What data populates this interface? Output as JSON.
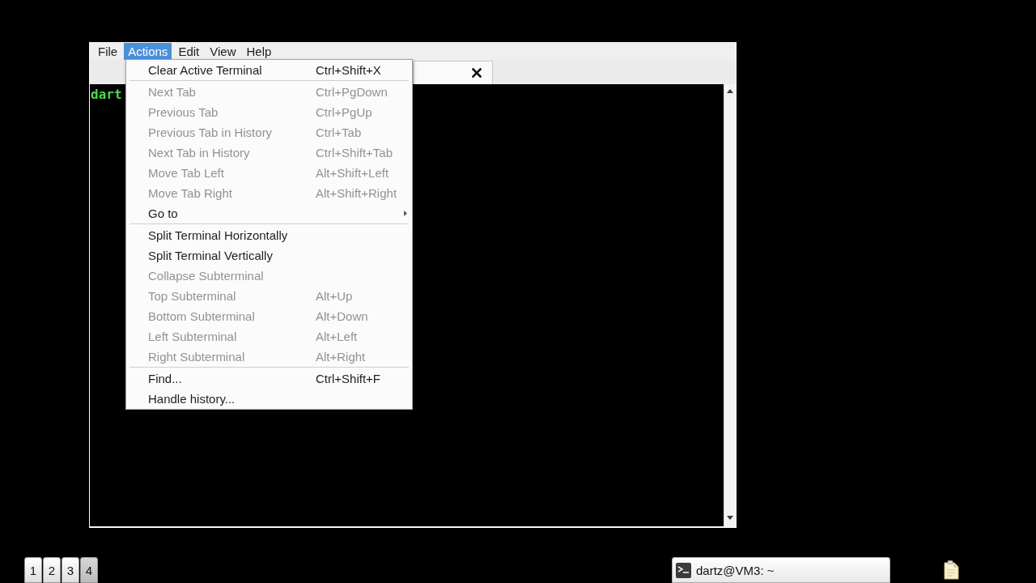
{
  "window": {
    "menubar": [
      {
        "label": "File",
        "selected": false
      },
      {
        "label": "Actions",
        "selected": true
      },
      {
        "label": "Edit",
        "selected": false
      },
      {
        "label": "View",
        "selected": false
      },
      {
        "label": "Help",
        "selected": false
      }
    ],
    "tabs": [
      {
        "selected": true
      }
    ],
    "terminal": {
      "lines": [
        "dart"
      ]
    }
  },
  "actions_menu": {
    "sections": [
      {
        "items": [
          {
            "kind": "command",
            "label": "Clear Active Terminal",
            "shortcut": "Ctrl+Shift+X",
            "disabled": false
          }
        ]
      },
      {
        "items": [
          {
            "kind": "command",
            "label": "Next Tab",
            "shortcut": "Ctrl+PgDown",
            "disabled": true
          },
          {
            "kind": "command",
            "label": "Previous Tab",
            "shortcut": "Ctrl+PgUp",
            "disabled": true
          },
          {
            "kind": "command",
            "label": "Previous Tab in History",
            "shortcut": "Ctrl+Tab",
            "disabled": true
          },
          {
            "kind": "command",
            "label": "Next Tab in History",
            "shortcut": "Ctrl+Shift+Tab",
            "disabled": true
          },
          {
            "kind": "command",
            "label": "Move Tab Left",
            "shortcut": "Alt+Shift+Left",
            "disabled": true
          },
          {
            "kind": "command",
            "label": "Move Tab Right",
            "shortcut": "Alt+Shift+Right",
            "disabled": true
          },
          {
            "kind": "submenu",
            "label": "Go to",
            "disabled": false
          }
        ]
      },
      {
        "items": [
          {
            "kind": "command",
            "label": "Split Terminal Horizontally",
            "disabled": false
          },
          {
            "kind": "command",
            "label": "Split Terminal Vertically",
            "disabled": false
          },
          {
            "kind": "command",
            "label": "Collapse Subterminal",
            "disabled": true
          },
          {
            "kind": "command",
            "label": "Top Subterminal",
            "shortcut": "Alt+Up",
            "disabled": true
          },
          {
            "kind": "command",
            "label": "Bottom Subterminal",
            "shortcut": "Alt+Down",
            "disabled": true
          },
          {
            "kind": "command",
            "label": "Left Subterminal",
            "shortcut": "Alt+Left",
            "disabled": true
          },
          {
            "kind": "command",
            "label": "Right Subterminal",
            "shortcut": "Alt+Right",
            "disabled": true
          }
        ]
      },
      {
        "items": [
          {
            "kind": "command",
            "label": "Find...",
            "shortcut": "Ctrl+Shift+F",
            "disabled": false
          },
          {
            "kind": "command",
            "label": "Handle history...",
            "disabled": false
          }
        ]
      }
    ]
  },
  "taskbar": {
    "workspaces": [
      {
        "label": "1",
        "selected": false
      },
      {
        "label": "2",
        "selected": false
      },
      {
        "label": "3",
        "selected": false
      },
      {
        "label": "4",
        "selected": true
      }
    ],
    "tasks": [
      {
        "title": "dartz@VM3: ~"
      }
    ]
  }
}
